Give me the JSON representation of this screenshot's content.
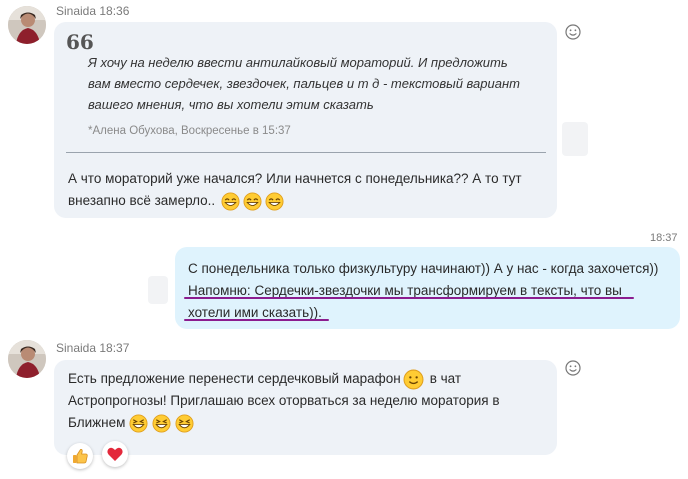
{
  "messages": [
    {
      "sender": "Sinaida",
      "time": "18:36",
      "quote": {
        "text": "Я хочу на неделю ввести антилайковый мораторий. И предложить вам вместо сердечек, звездочек, пальцев и т д - текстовый вариант вашего мнения, что вы хотели этим сказать",
        "author": "*Алена Обухова, Воскресенье в 15:37"
      },
      "text_line1": "А что мораторий уже начался? Или начнется с понедельника?? А то тут",
      "text_line2": "внезапно всё замерло.."
    },
    {
      "sender": "me",
      "time": "18:37",
      "text_line1": "С понедельника только физкультуру начинают)) А у нас - когда захочется))",
      "text_line2": "Напомню: Сердечки-звездочки мы трансформируем в тексты, что вы",
      "text_line3": "хотели ими сказать))."
    },
    {
      "sender": "Sinaida",
      "time": "18:37",
      "text_line1a": "Есть предложение перенести сердечковый марафон",
      "text_line1b": "в чат",
      "text_line2": "Астропрогнозы! Приглашаю всех оторваться за неделю моратория в",
      "text_line3": "Ближнем",
      "reactions": [
        "thumbs-up-icon",
        "heart-icon"
      ]
    }
  ],
  "colors": {
    "incoming_bubble": "#eef2f7",
    "outgoing_bubble": "#dff3fd",
    "underline": "#8b1d8f"
  }
}
